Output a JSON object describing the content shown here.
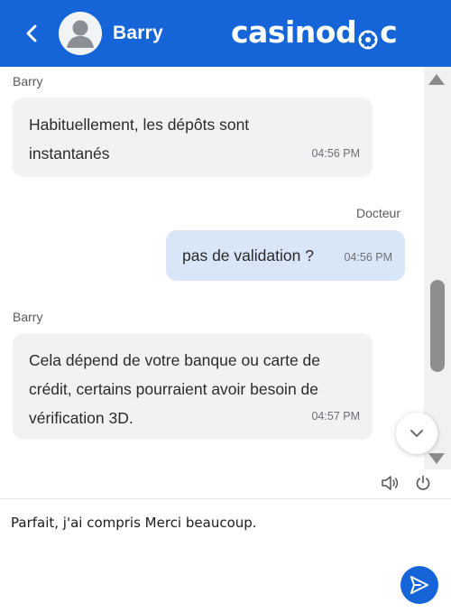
{
  "header": {
    "agent_name": "Barry",
    "logo_left": "casinod",
    "logo_right": "c"
  },
  "messages": [
    {
      "sender": "Barry",
      "direction": "incoming",
      "lines": [
        "Habituellement, les dépôts sont",
        "instantanés"
      ],
      "time": "04:56 PM"
    },
    {
      "sender": "Docteur",
      "direction": "outgoing",
      "lines": [
        "pas de validation ?"
      ],
      "time": "04:56 PM"
    },
    {
      "sender": "Barry",
      "direction": "incoming",
      "lines": [
        "Cela dépend de votre banque ou carte de",
        "crédit, certains pourraient avoir besoin de",
        "vérification 3D."
      ],
      "time": "04:57 PM"
    }
  ],
  "composer": {
    "value": "Parfait, j'ai compris Merci beaucoup."
  },
  "icons": {
    "back": "chevron-left-icon",
    "avatar": "user-avatar-icon",
    "scroll_down": "chevron-down-icon",
    "sound": "speaker-icon",
    "power": "power-icon",
    "send": "send-icon"
  },
  "colors": {
    "brand": "#1565d8",
    "incoming_bubble": "#f1f2f4",
    "outgoing_bubble": "#d9e6f8"
  }
}
